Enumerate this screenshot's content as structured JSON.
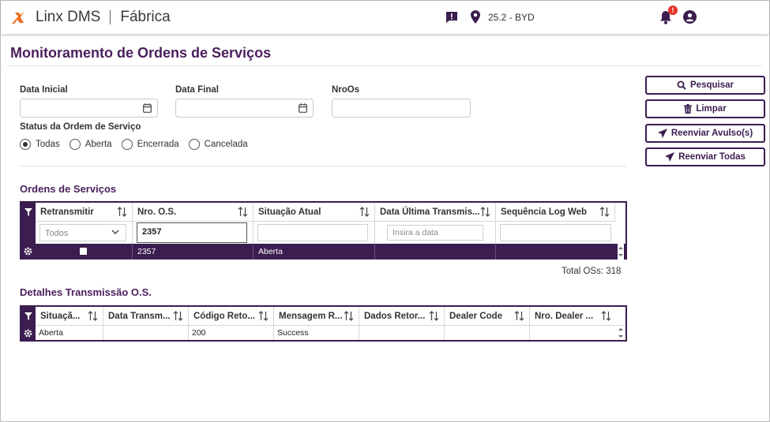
{
  "header": {
    "app_name": "Linx DMS",
    "module": "Fábrica",
    "version_store": "25.2 - BYD",
    "notification_badge": "!",
    "icons": [
      "linx-logo-icon",
      "chat-icon",
      "location-pin-icon",
      "bell-icon",
      "user-icon"
    ],
    "colors": {
      "primary": "#3b1d4f",
      "title": "#4a1f5c",
      "logo": "#f06e1d",
      "badge": "#e3332a"
    }
  },
  "page": {
    "title": "Monitoramento de Ordens de Serviços"
  },
  "filters": {
    "data_inicial_label": "Data Inicial",
    "data_final_label": "Data Final",
    "nroos_label": "NroOs",
    "status_label": "Status da Ordem de Serviço",
    "status_options": [
      {
        "label": "Todas",
        "checked": true
      },
      {
        "label": "Aberta",
        "checked": false
      },
      {
        "label": "Encerrada",
        "checked": false
      },
      {
        "label": "Cancelada",
        "checked": false
      }
    ]
  },
  "actions": {
    "pesquisar": "Pesquisar",
    "limpar": "Limpar",
    "reenviar_avulso": "Reenviar Avulso(s)",
    "reenviar_todas": "Reenviar Todas"
  },
  "orders_grid": {
    "title": "Ordens de Serviços",
    "columns": [
      "Retransmitir",
      "Nro. O.S.",
      "Situação Atual",
      "Data Última Transmis...",
      "Sequência Log Web"
    ],
    "filter_select_value": "Todos",
    "filter_nro_value": "2357",
    "filter_date_placeholder": "Insira a data",
    "rows": [
      {
        "retransmitir": false,
        "nro": "2357",
        "situacao": "Aberta",
        "data": "",
        "sequencia": ""
      }
    ],
    "total_label": "Total OSs: 318"
  },
  "details_grid": {
    "title": "Detalhes Transmissão O.S.",
    "columns": [
      "Situaçã...",
      "Data Transm...",
      "Código Reto...",
      "Mensagem R...",
      "Dados Retor...",
      "Dealer Code",
      "Nro. Dealer ..."
    ],
    "rows": [
      {
        "situacao": "Aberta",
        "data": "",
        "codigo": "200",
        "mensagem": "Success",
        "dados": "",
        "dealer": "",
        "nro_dealer": ""
      }
    ]
  }
}
